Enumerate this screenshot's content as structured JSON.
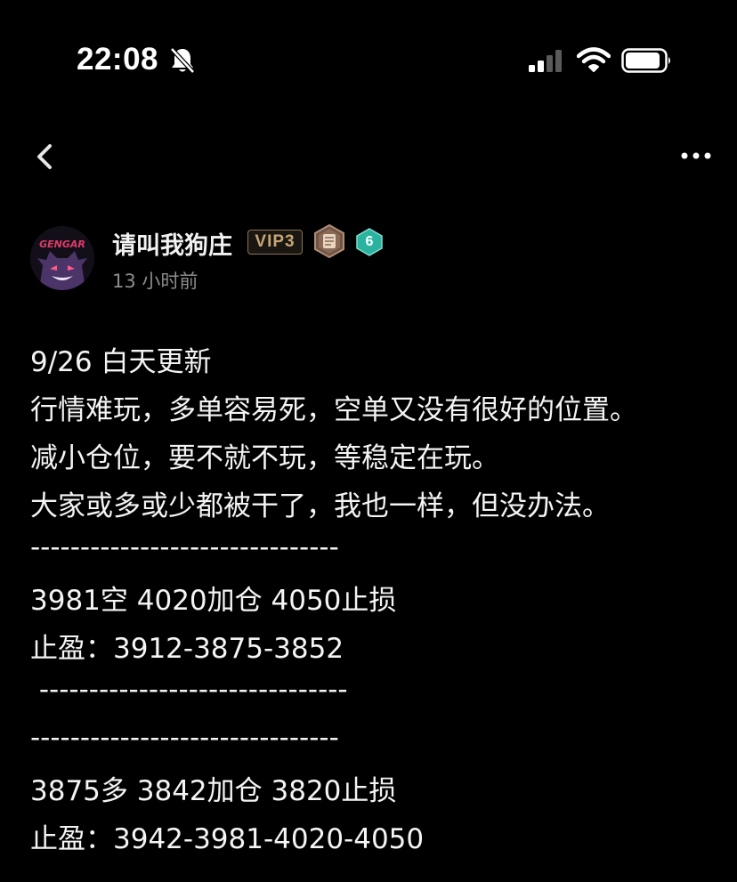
{
  "status": {
    "time": "22:08",
    "icons": [
      "bell-slash-icon",
      "cellular-signal-icon",
      "wifi-icon",
      "battery-icon"
    ]
  },
  "nav": {
    "back_icon": "chevron-left-icon",
    "more_icon": "ellipsis-icon"
  },
  "author": {
    "name": "请叫我狗庄",
    "vip": "VIP3",
    "level": "6",
    "time_ago": "13 小时前",
    "avatar_text": "GENGAR",
    "colors": {
      "vip": "#c7a675",
      "level": "#2bb3a0",
      "rank": "#8a6a55"
    }
  },
  "post": {
    "lines": [
      "9/26 白天更新",
      "行情难玩，多单容易死，空单又没有很好的位置。",
      "减小仓位，要不就不玩，等稳定在玩。",
      "大家或多或少都被干了，我也一样，但没办法。",
      "-------------------------------",
      "3981空 4020加仓 4050止损",
      "止盈：3912-3875-3852",
      " -------------------------------",
      "-------------------------------",
      "3875多 3842加仓 3820止损",
      "止盈：3942-3981-4020-4050"
    ]
  }
}
